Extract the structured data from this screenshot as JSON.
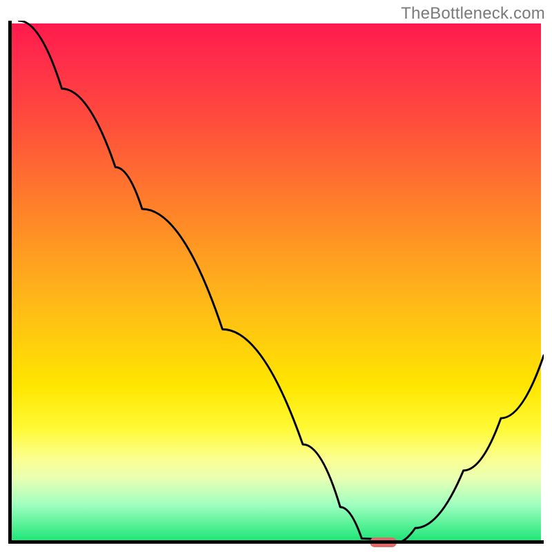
{
  "watermark": "TheBottleneck.com",
  "chart_data": {
    "type": "line",
    "title": "",
    "xlabel": "",
    "ylabel": "",
    "xlim": [
      0,
      100
    ],
    "ylim": [
      0,
      100
    ],
    "grid": false,
    "legend": null,
    "curve_points": [
      {
        "x": 2,
        "y": 100
      },
      {
        "x": 10,
        "y": 87
      },
      {
        "x": 20,
        "y": 72
      },
      {
        "x": 25,
        "y": 64
      },
      {
        "x": 40,
        "y": 41
      },
      {
        "x": 55,
        "y": 19
      },
      {
        "x": 62,
        "y": 7
      },
      {
        "x": 66,
        "y": 1
      },
      {
        "x": 72,
        "y": 0
      },
      {
        "x": 76,
        "y": 3
      },
      {
        "x": 85,
        "y": 14
      },
      {
        "x": 92,
        "y": 24
      },
      {
        "x": 100,
        "y": 36
      }
    ],
    "optimum_marker": {
      "x": 70,
      "y": 0,
      "width_pct": 5
    },
    "gradient_stops": [
      {
        "pct": 0,
        "color": "#ff1a4d"
      },
      {
        "pct": 35,
        "color": "#ff7f2a"
      },
      {
        "pct": 70,
        "color": "#ffe600"
      },
      {
        "pct": 100,
        "color": "#1de676"
      }
    ],
    "axes_color": "#000000",
    "curve_color": "#000000",
    "marker_color": "#e06a6a"
  }
}
